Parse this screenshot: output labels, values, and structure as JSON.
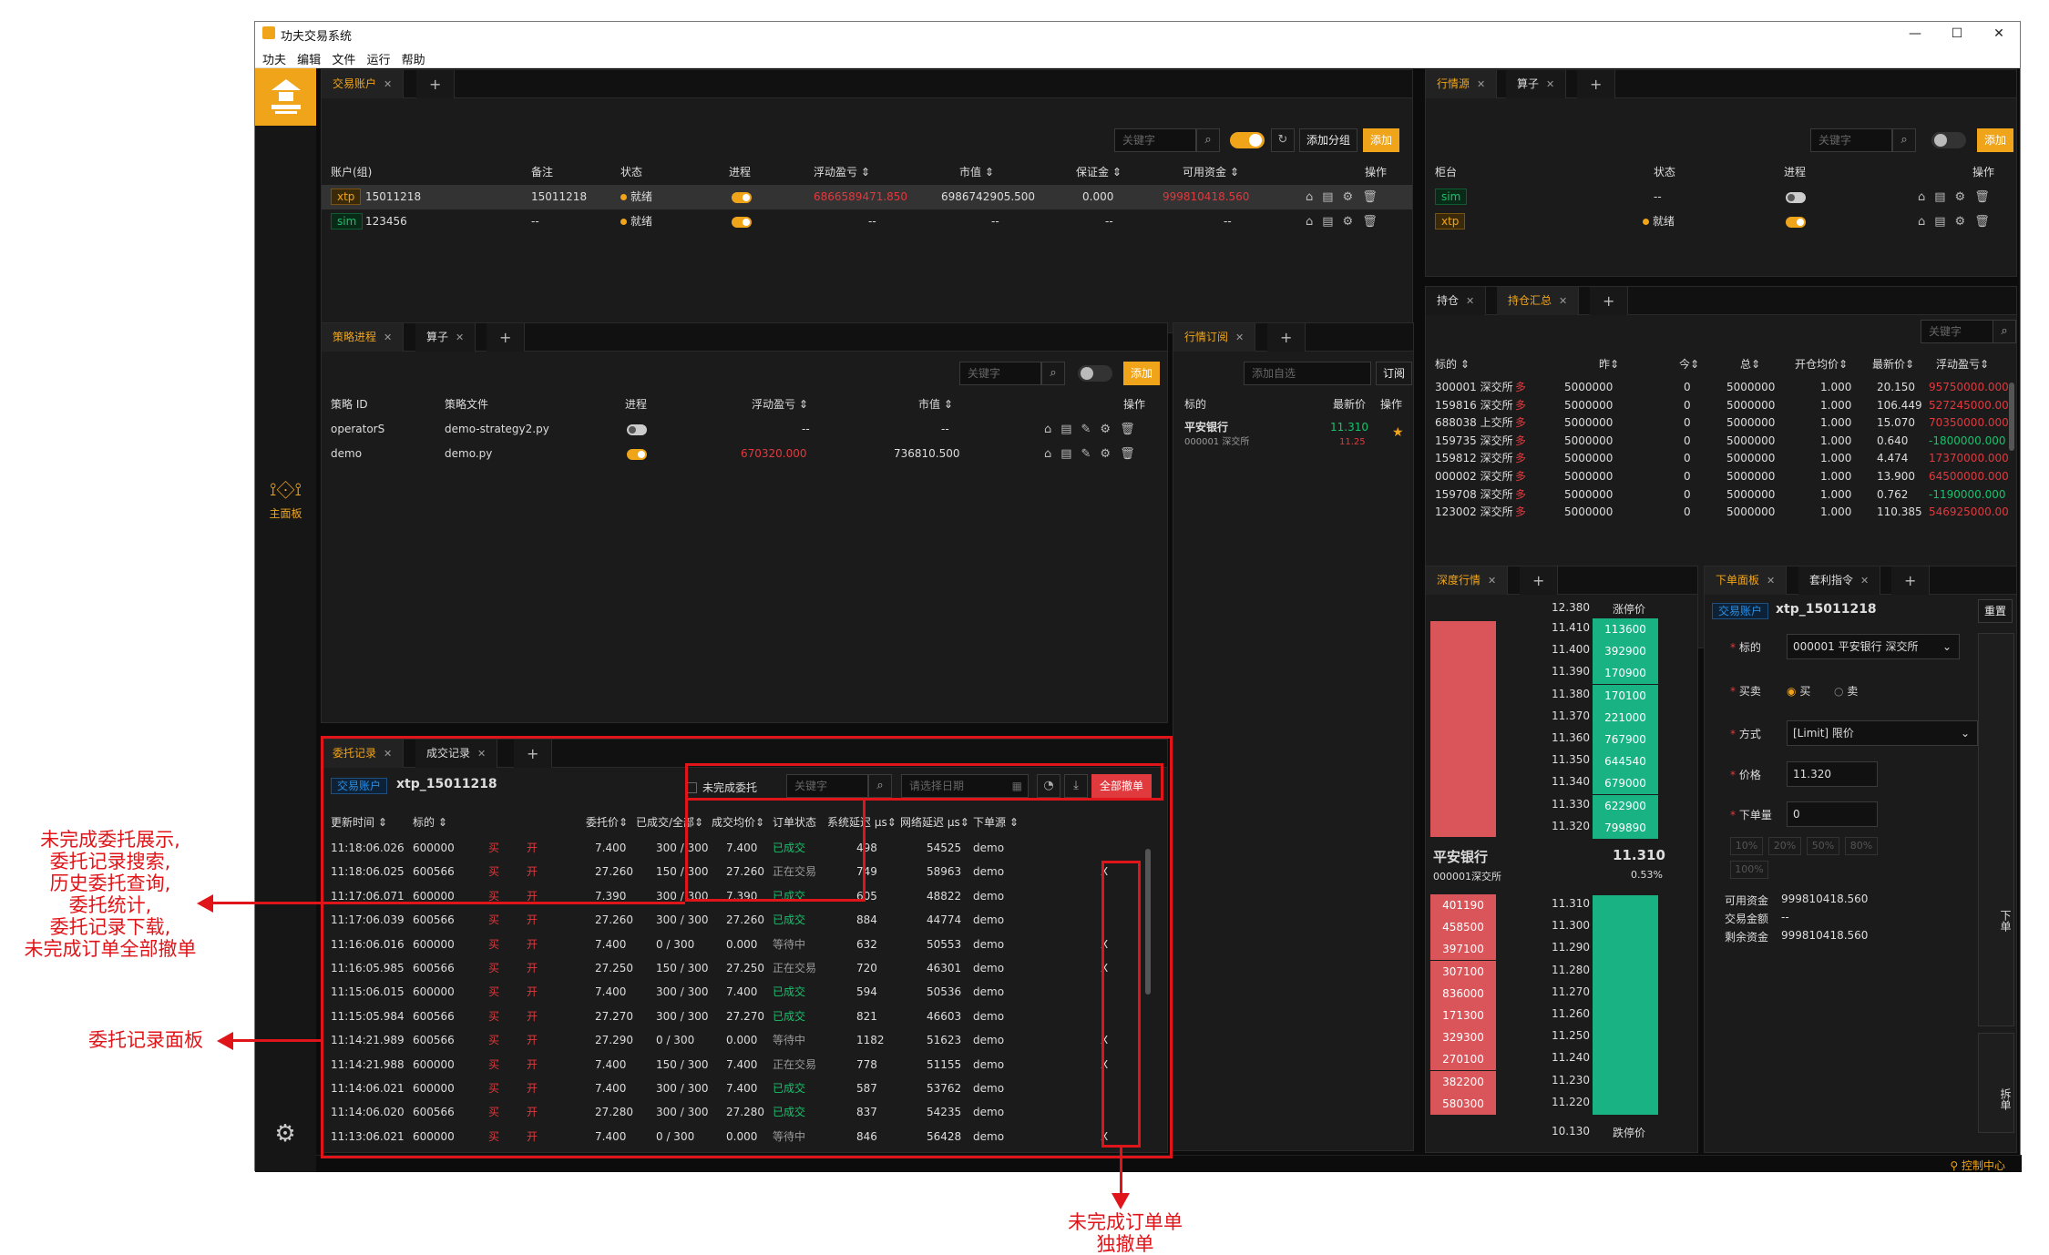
{
  "window": {
    "title": "功夫交易系统",
    "menu": [
      "功夫",
      "编辑",
      "文件",
      "运行",
      "帮助"
    ],
    "min": "—",
    "max": "☐",
    "close": "✕"
  },
  "sidebar": {
    "nav_label": "主面板",
    "nav_icon": "dashboard-icon",
    "settings_icon": "gear-icon"
  },
  "statusbar": {
    "control_center": "控制中心"
  },
  "accounts": {
    "tabs": [
      {
        "label": "交易账户"
      }
    ],
    "search_placeholder": "关键字",
    "add_group": "添加分组",
    "add": "添加",
    "headers": [
      "账户(组)",
      "备注",
      "状态",
      "进程",
      "浮动盈亏 ⇕",
      "市值 ⇕",
      "保证金 ⇕",
      "可用资金 ⇕",
      "操作"
    ],
    "rows": [
      {
        "source": "xtp",
        "id": "15011218",
        "note": "15011218",
        "status": "就绪",
        "process": "on",
        "pnl": "6866589471.850",
        "value": "6986742905.500",
        "margin": "0.000",
        "available": "999810418.560"
      },
      {
        "source": "sim",
        "id": "123456",
        "note": "--",
        "status": "就绪",
        "process": "on",
        "pnl": "--",
        "value": "--",
        "margin": "--",
        "available": "--"
      }
    ]
  },
  "sources": {
    "tabs": [
      {
        "label": "行情源"
      },
      {
        "label": "算子"
      }
    ],
    "search_placeholder": "关键字",
    "add": "添加",
    "headers": [
      "柜台",
      "状态",
      "进程",
      "操作"
    ],
    "rows": [
      {
        "name": "sim",
        "status": "--",
        "process": "off"
      },
      {
        "name": "xtp",
        "status": "就绪",
        "process": "on"
      }
    ]
  },
  "strategies": {
    "tabs": [
      {
        "label": "策略进程"
      },
      {
        "label": "算子"
      }
    ],
    "search_placeholder": "关键字",
    "add": "添加",
    "headers": [
      "策略 ID",
      "策略文件",
      "进程",
      "浮动盈亏 ⇕",
      "市值 ⇕",
      "操作"
    ],
    "rows": [
      {
        "id": "operatorS",
        "file": "demo-strategy2.py",
        "process": "off",
        "pnl": "--",
        "value": "--"
      },
      {
        "id": "demo",
        "file": "demo.py",
        "process": "on",
        "pnl": "670320.000",
        "value": "736810.500"
      }
    ]
  },
  "quote_sub": {
    "tabs": [
      {
        "label": "行情订阅"
      }
    ],
    "add_placeholder": "添加自选",
    "subscribe": "订阅",
    "headers": [
      "标的",
      "最新价",
      "操作"
    ],
    "rows": [
      {
        "name": "平安银行",
        "code": "000001 深交所",
        "price": "11.310",
        "change": "11.25"
      }
    ]
  },
  "positions": {
    "tabs": [
      {
        "label": "持仓"
      },
      {
        "label": "持仓汇总"
      }
    ],
    "search_placeholder": "关键字",
    "headers": [
      "标的 ⇕",
      "昨⇕",
      "今⇕",
      "总⇕",
      "开仓均价⇕",
      "最新价⇕",
      "浮动盈亏⇕"
    ],
    "rows": [
      {
        "code": "300001 深交所",
        "dir": "多",
        "yd": "5000000",
        "td": "0",
        "total": "5000000",
        "avg": "1.000",
        "last": "20.150",
        "pnl": "95750000.000",
        "pos": true
      },
      {
        "code": "159816 深交所",
        "dir": "多",
        "yd": "5000000",
        "td": "0",
        "total": "5000000",
        "avg": "1.000",
        "last": "106.449",
        "pnl": "527245000.000",
        "pos": true
      },
      {
        "code": "688038 上交所",
        "dir": "多",
        "yd": "5000000",
        "td": "0",
        "total": "5000000",
        "avg": "1.000",
        "last": "15.070",
        "pnl": "70350000.000",
        "pos": true
      },
      {
        "code": "159735 深交所",
        "dir": "多",
        "yd": "5000000",
        "td": "0",
        "total": "5000000",
        "avg": "1.000",
        "last": "0.640",
        "pnl": "-1800000.000",
        "pos": false
      },
      {
        "code": "159812 深交所",
        "dir": "多",
        "yd": "5000000",
        "td": "0",
        "total": "5000000",
        "avg": "1.000",
        "last": "4.474",
        "pnl": "17370000.000",
        "pos": true
      },
      {
        "code": "000002 深交所",
        "dir": "多",
        "yd": "5000000",
        "td": "0",
        "total": "5000000",
        "avg": "1.000",
        "last": "13.900",
        "pnl": "64500000.000",
        "pos": true
      },
      {
        "code": "159708 深交所",
        "dir": "多",
        "yd": "5000000",
        "td": "0",
        "total": "5000000",
        "avg": "1.000",
        "last": "0.762",
        "pnl": "-1190000.000",
        "pos": false
      },
      {
        "code": "123002 深交所",
        "dir": "多",
        "yd": "5000000",
        "td": "0",
        "total": "5000000",
        "avg": "1.000",
        "last": "110.385",
        "pnl": "546925000.000",
        "pos": true
      }
    ]
  },
  "depth": {
    "tabs": [
      {
        "label": "深度行情"
      }
    ],
    "limit_up_label": "涨停价",
    "limit_down_label": "跌停价",
    "limit_up": "12.380",
    "limit_down": "10.130",
    "asks": [
      [
        "11.410",
        "113600"
      ],
      [
        "11.400",
        "392900"
      ],
      [
        "11.390",
        "170900"
      ],
      [
        "11.380",
        "170100"
      ],
      [
        "11.370",
        "221000"
      ],
      [
        "11.360",
        "767900"
      ],
      [
        "11.350",
        "644540"
      ],
      [
        "11.340",
        "679000"
      ],
      [
        "11.330",
        "622900"
      ],
      [
        "11.320",
        "799890"
      ]
    ],
    "bids": [
      [
        "11.310",
        "401190"
      ],
      [
        "11.300",
        "458500"
      ],
      [
        "11.290",
        "397100"
      ],
      [
        "11.280",
        "307100"
      ],
      [
        "11.270",
        "836000"
      ],
      [
        "11.260",
        "171300"
      ],
      [
        "11.250",
        "329300"
      ],
      [
        "11.240",
        "270100"
      ],
      [
        "11.230",
        "382200"
      ],
      [
        "11.220",
        "580300"
      ]
    ],
    "name": "平安银行",
    "code": "000001深交所",
    "last": "11.310",
    "change": "0.53%"
  },
  "order_panel": {
    "tabs": [
      {
        "label": "下单面板"
      },
      {
        "label": "套利指令"
      }
    ],
    "account_badge": "交易账户",
    "account": "xtp_15011218",
    "reset": "重置",
    "labels": {
      "instrument": "标的",
      "side": "买卖",
      "method": "方式",
      "price": "价格",
      "volume": "下单量"
    },
    "instrument": "000001 平安银行 深交所",
    "buy": "买",
    "sell": "卖",
    "method": "[Limit] 限价",
    "price": "11.320",
    "volume": "0",
    "pcts": [
      "10%",
      "20%",
      "50%",
      "80%",
      "100%"
    ],
    "available_label": "可用资金",
    "available": "999810418.560",
    "trade_amount_label": "交易金额",
    "trade_amount": "--",
    "remaining_label": "剩余资金",
    "remaining": "999810418.560",
    "place_order": "下单",
    "split_order": "拆单"
  },
  "orders": {
    "tabs": [
      {
        "label": "委托记录"
      },
      {
        "label": "成交记录"
      }
    ],
    "account_badge": "交易账户",
    "account": "xtp_15011218",
    "unfinished_label": "未完成委托",
    "search_placeholder": "关键字",
    "date_placeholder": "请选择日期",
    "cancel_all": "全部撤单",
    "headers": [
      "更新时间 ⇕",
      "标的 ⇕",
      "",
      "",
      "委托价⇕",
      "已成交/全部⇕",
      "成交均价⇕",
      "订单状态",
      "系统延迟 μs⇕",
      "网络延迟 μs⇕",
      "下单源 ⇕"
    ],
    "rows": [
      {
        "time": "11:18:06.026",
        "code": "600000",
        "side": "买",
        "offset": "开",
        "price": "7.400",
        "filled": "300 / 300",
        "avg": "7.400",
        "status": "已成交",
        "sys": "498",
        "net": "54525",
        "src": "demo",
        "cancel": ""
      },
      {
        "time": "11:18:06.025",
        "code": "600566",
        "side": "买",
        "offset": "开",
        "price": "27.260",
        "filled": "150 / 300",
        "avg": "27.260",
        "status": "正在交易",
        "sys": "749",
        "net": "58963",
        "src": "demo",
        "cancel": "X"
      },
      {
        "time": "11:17:06.071",
        "code": "600000",
        "side": "买",
        "offset": "开",
        "price": "7.390",
        "filled": "300 / 300",
        "avg": "7.390",
        "status": "已成交",
        "sys": "605",
        "net": "48822",
        "src": "demo",
        "cancel": ""
      },
      {
        "time": "11:17:06.039",
        "code": "600566",
        "side": "买",
        "offset": "开",
        "price": "27.260",
        "filled": "300 / 300",
        "avg": "27.260",
        "status": "已成交",
        "sys": "884",
        "net": "44774",
        "src": "demo",
        "cancel": ""
      },
      {
        "time": "11:16:06.016",
        "code": "600000",
        "side": "买",
        "offset": "开",
        "price": "7.400",
        "filled": "0 / 300",
        "avg": "0.000",
        "status": "等待中",
        "sys": "632",
        "net": "50553",
        "src": "demo",
        "cancel": "X"
      },
      {
        "time": "11:16:05.985",
        "code": "600566",
        "side": "买",
        "offset": "开",
        "price": "27.250",
        "filled": "150 / 300",
        "avg": "27.250",
        "status": "正在交易",
        "sys": "720",
        "net": "46301",
        "src": "demo",
        "cancel": "X"
      },
      {
        "time": "11:15:06.015",
        "code": "600000",
        "side": "买",
        "offset": "开",
        "price": "7.400",
        "filled": "300 / 300",
        "avg": "7.400",
        "status": "已成交",
        "sys": "594",
        "net": "50536",
        "src": "demo",
        "cancel": ""
      },
      {
        "time": "11:15:05.984",
        "code": "600566",
        "side": "买",
        "offset": "开",
        "price": "27.270",
        "filled": "300 / 300",
        "avg": "27.270",
        "status": "已成交",
        "sys": "821",
        "net": "46603",
        "src": "demo",
        "cancel": ""
      },
      {
        "time": "11:14:21.989",
        "code": "600566",
        "side": "买",
        "offset": "开",
        "price": "27.290",
        "filled": "0 / 300",
        "avg": "0.000",
        "status": "等待中",
        "sys": "1182",
        "net": "51623",
        "src": "demo",
        "cancel": "X"
      },
      {
        "time": "11:14:21.988",
        "code": "600000",
        "side": "买",
        "offset": "开",
        "price": "7.400",
        "filled": "150 / 300",
        "avg": "7.400",
        "status": "正在交易",
        "sys": "778",
        "net": "51155",
        "src": "demo",
        "cancel": "X"
      },
      {
        "time": "11:14:06.021",
        "code": "600000",
        "side": "买",
        "offset": "开",
        "price": "7.400",
        "filled": "300 / 300",
        "avg": "7.400",
        "status": "已成交",
        "sys": "587",
        "net": "53762",
        "src": "demo",
        "cancel": ""
      },
      {
        "time": "11:14:06.020",
        "code": "600566",
        "side": "买",
        "offset": "开",
        "price": "27.280",
        "filled": "300 / 300",
        "avg": "27.280",
        "status": "已成交",
        "sys": "837",
        "net": "54235",
        "src": "demo",
        "cancel": ""
      },
      {
        "time": "11:13:06.021",
        "code": "600000",
        "side": "买",
        "offset": "开",
        "price": "7.400",
        "filled": "0 / 300",
        "avg": "0.000",
        "status": "等待中",
        "sys": "846",
        "net": "56428",
        "src": "demo",
        "cancel": "X"
      }
    ]
  },
  "annotations": {
    "left_top": [
      "未完成委托展示,",
      "委托记录搜索,",
      "历史委托查询,",
      "委托统计,",
      "委托记录下载,",
      "未完成订单全部撤单"
    ],
    "left_mid": "委托记录面板",
    "bottom": [
      "未完成订单单",
      "独撤单"
    ]
  }
}
